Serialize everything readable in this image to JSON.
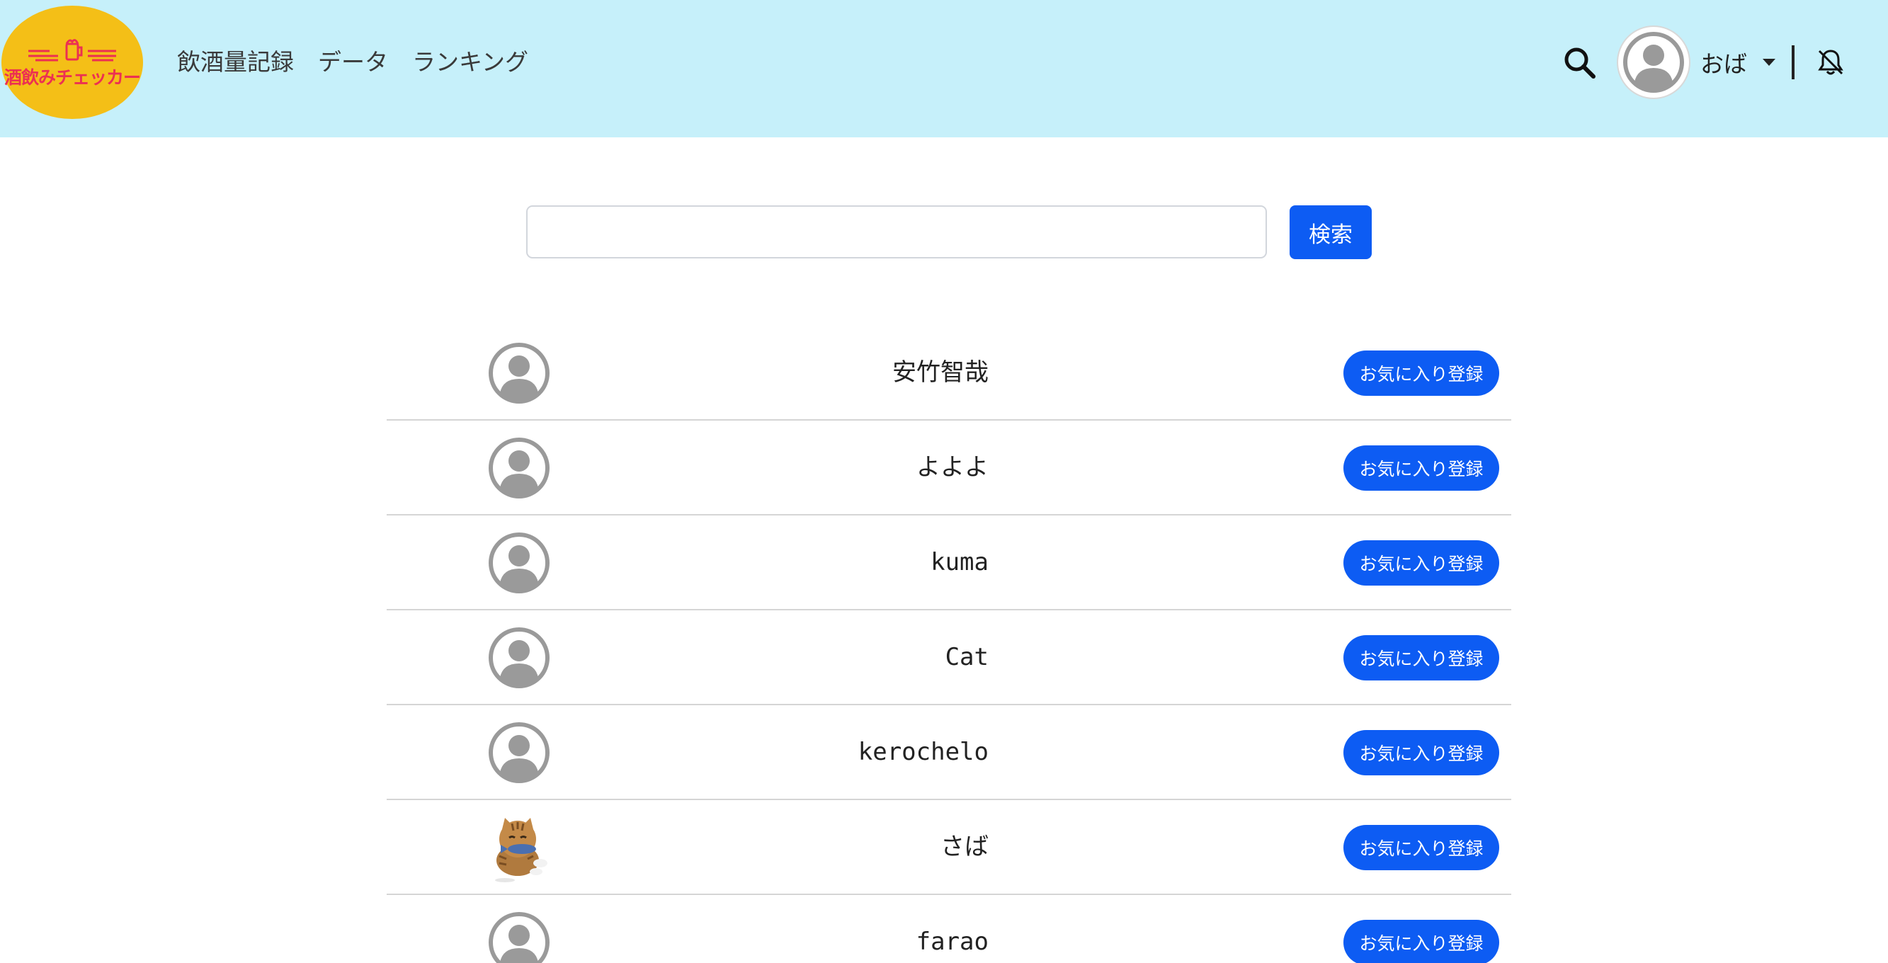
{
  "brand": {
    "logo_text": "酒飲みチェッカー",
    "logo_color": "#f4bf17",
    "text_color": "#ec3052"
  },
  "nav": {
    "items": [
      {
        "label": "飲酒量記録"
      },
      {
        "label": "データ"
      },
      {
        "label": "ランキング"
      }
    ]
  },
  "header": {
    "user_name": "おば",
    "search_icon": "search-icon",
    "bell_icon": "bell-off-icon",
    "background": "#c6f0fa"
  },
  "search": {
    "value": "",
    "placeholder": "",
    "button_label": "検索"
  },
  "accent_color": "#0d5cf3",
  "users": [
    {
      "name": "安竹智哉",
      "avatar": "default-avatar-icon",
      "button_label": "お気に入り登録"
    },
    {
      "name": "よよよ",
      "avatar": "default-avatar-icon",
      "button_label": "お気に入り登録"
    },
    {
      "name": "kuma",
      "avatar": "default-avatar-icon",
      "button_label": "お気に入り登録"
    },
    {
      "name": "Cat",
      "avatar": "default-avatar-icon",
      "button_label": "お気に入り登録"
    },
    {
      "name": "kerochelo",
      "avatar": "default-avatar-icon",
      "button_label": "お気に入り登録"
    },
    {
      "name": "さば",
      "avatar": "cat-eating-fish-icon",
      "button_label": "お気に入り登録"
    },
    {
      "name": "farao",
      "avatar": "default-avatar-icon",
      "button_label": "お気に入り登録"
    }
  ]
}
